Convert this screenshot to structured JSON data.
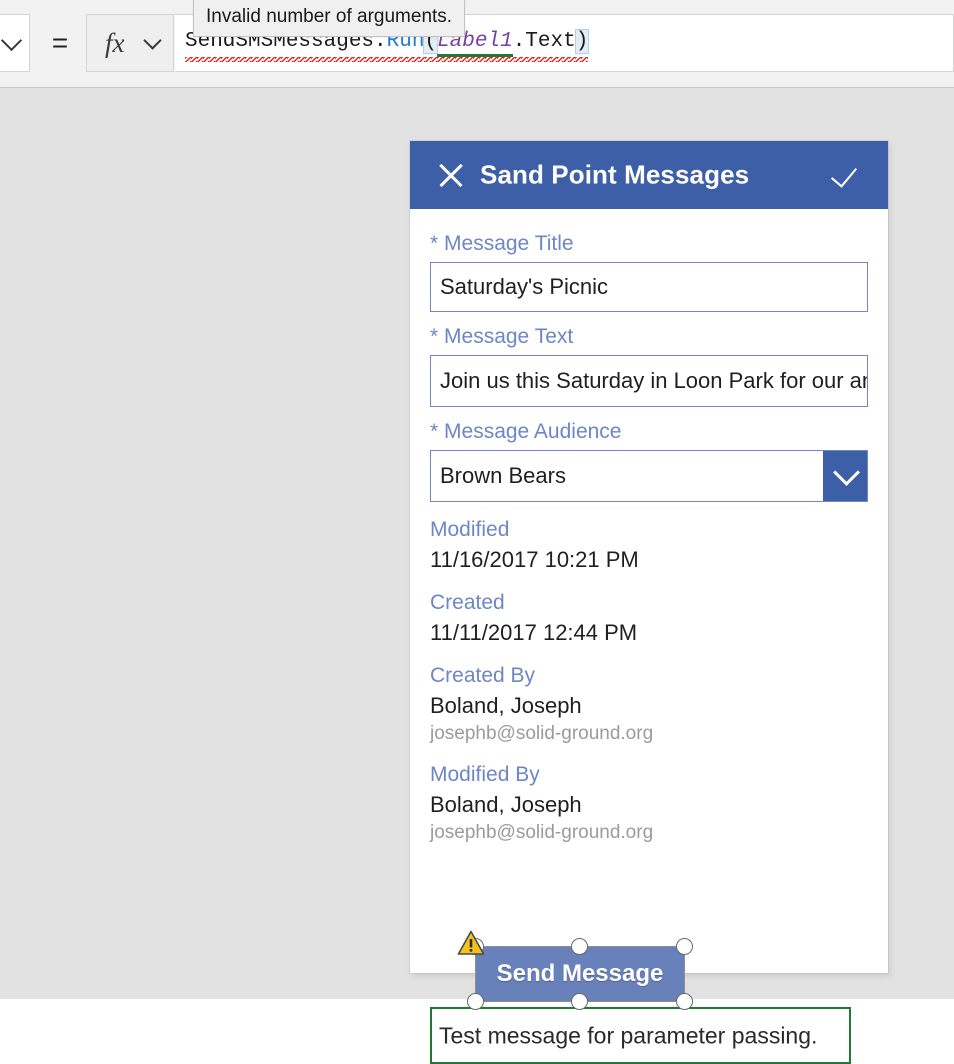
{
  "formula_bar": {
    "property_dropdown_icon": "chevron-down-icon",
    "equals": "=",
    "fx_label": "fx",
    "tooltip": "Invalid number of arguments.",
    "formula": {
      "full": "SendSMSMessages.Run(Label1.Text)",
      "tokens": {
        "source": "SendSMSMessages.",
        "method": "Run",
        "open_paren": "(",
        "identifier": "Label1",
        "property": ".Text",
        "close_paren": ")"
      }
    }
  },
  "app": {
    "header": {
      "title": "Sand Point Messages",
      "close_icon": "close-icon",
      "confirm_icon": "checkmark-icon"
    },
    "fields": [
      {
        "required_marker": "*",
        "label": "Message Title",
        "value": "Saturday's Picnic",
        "type": "text"
      },
      {
        "required_marker": "*",
        "label": "Message Text",
        "value": "Join us this Saturday in Loon Park for our an",
        "type": "text"
      },
      {
        "required_marker": "*",
        "label": "Message Audience",
        "value": "Brown Bears",
        "type": "dropdown",
        "dropdown_icon": "chevron-down-icon"
      }
    ],
    "metadata": [
      {
        "label": "Modified",
        "value": "11/16/2017 10:21 PM",
        "sub": ""
      },
      {
        "label": "Created",
        "value": "11/11/2017 12:44 PM",
        "sub": ""
      },
      {
        "label": "Created By",
        "value": "Boland, Joseph",
        "sub": "josephb@solid-ground.org"
      },
      {
        "label": "Modified By",
        "value": "Boland, Joseph",
        "sub": "josephb@solid-ground.org"
      }
    ],
    "send_button": {
      "label": "Send Message",
      "warning_icon": "warning-triangle-icon",
      "selected": true
    },
    "label1": {
      "text": "Test message for parameter passing."
    }
  },
  "colors": {
    "header_blue": "#3d5fa8",
    "field_label_blue": "#6d86c6",
    "field_border_blue": "#7187c0",
    "button_fill": "#6881bb",
    "selection_green": "#1e7a34",
    "canvas_gray": "#e2e2e2",
    "error_red": "#e01b1b",
    "warning_yellow": "#f5c21b"
  }
}
